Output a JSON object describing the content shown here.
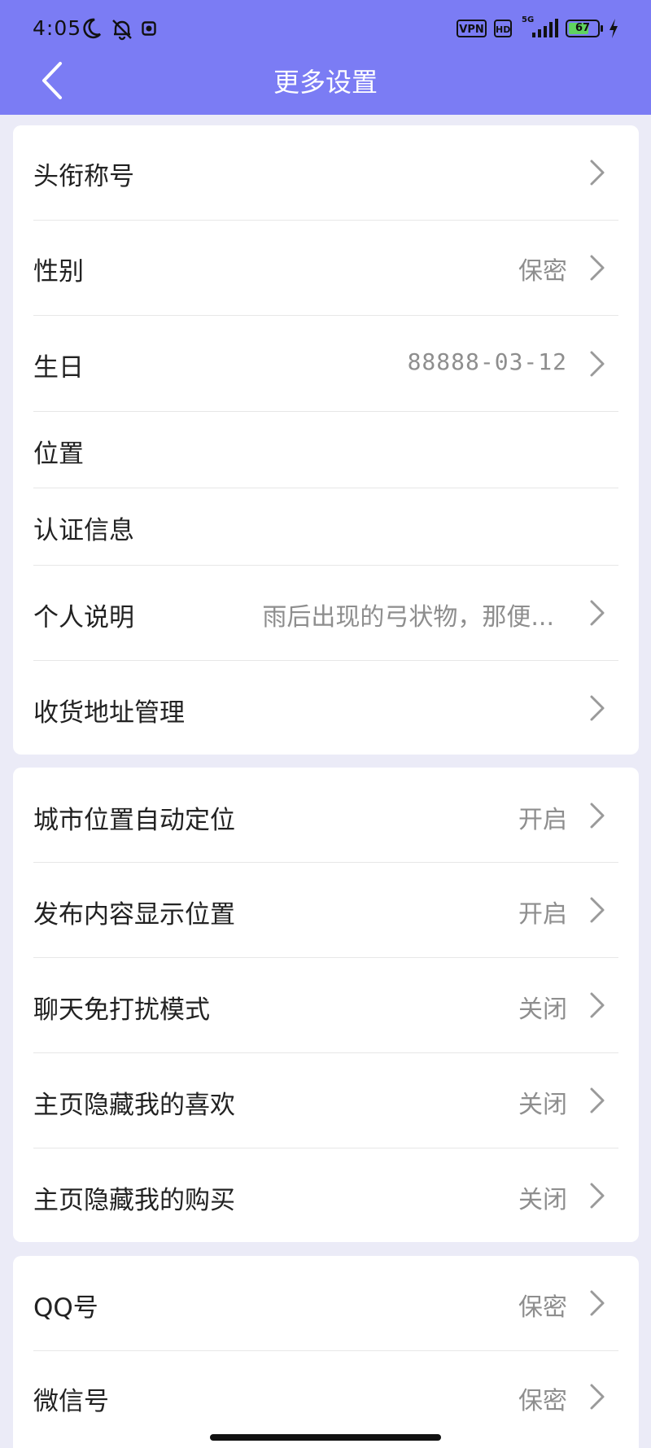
{
  "status": {
    "time": "4:05",
    "vpn": "VPN",
    "hd": "HD",
    "net": "5G",
    "battery": "67"
  },
  "nav": {
    "title": "更多设置"
  },
  "groups": [
    [
      {
        "label": "头衔称号",
        "value": "",
        "chevron": true
      },
      {
        "label": "性别",
        "value": "保密",
        "chevron": true
      },
      {
        "label": "生日",
        "value": "88888-03-12",
        "chevron": true
      },
      {
        "label": "位置",
        "value": "",
        "chevron": false
      },
      {
        "label": "认证信息",
        "value": "",
        "chevron": false
      },
      {
        "label": "个人说明",
        "value": "雨后出现的弓状物，那便...",
        "chevron": true
      },
      {
        "label": "收货地址管理",
        "value": "",
        "chevron": true
      }
    ],
    [
      {
        "label": "城市位置自动定位",
        "value": "开启",
        "chevron": true
      },
      {
        "label": "发布内容显示位置",
        "value": "开启",
        "chevron": true
      },
      {
        "label": "聊天免打扰模式",
        "value": "关闭",
        "chevron": true
      },
      {
        "label": "主页隐藏我的喜欢",
        "value": "关闭",
        "chevron": true
      },
      {
        "label": "主页隐藏我的购买",
        "value": "关闭",
        "chevron": true
      }
    ],
    [
      {
        "label": "QQ号",
        "value": "保密",
        "chevron": true
      },
      {
        "label": "微信号",
        "value": "保密",
        "chevron": true
      }
    ]
  ],
  "colors": {
    "accent": "#7b7cf4",
    "background": "#ebebf7"
  },
  "icons": [
    "moon-icon",
    "bell-off-icon",
    "app-notification-icon",
    "signal-icon",
    "battery-icon",
    "charging-icon",
    "back-arrow-icon",
    "chevron-right-icon"
  ]
}
